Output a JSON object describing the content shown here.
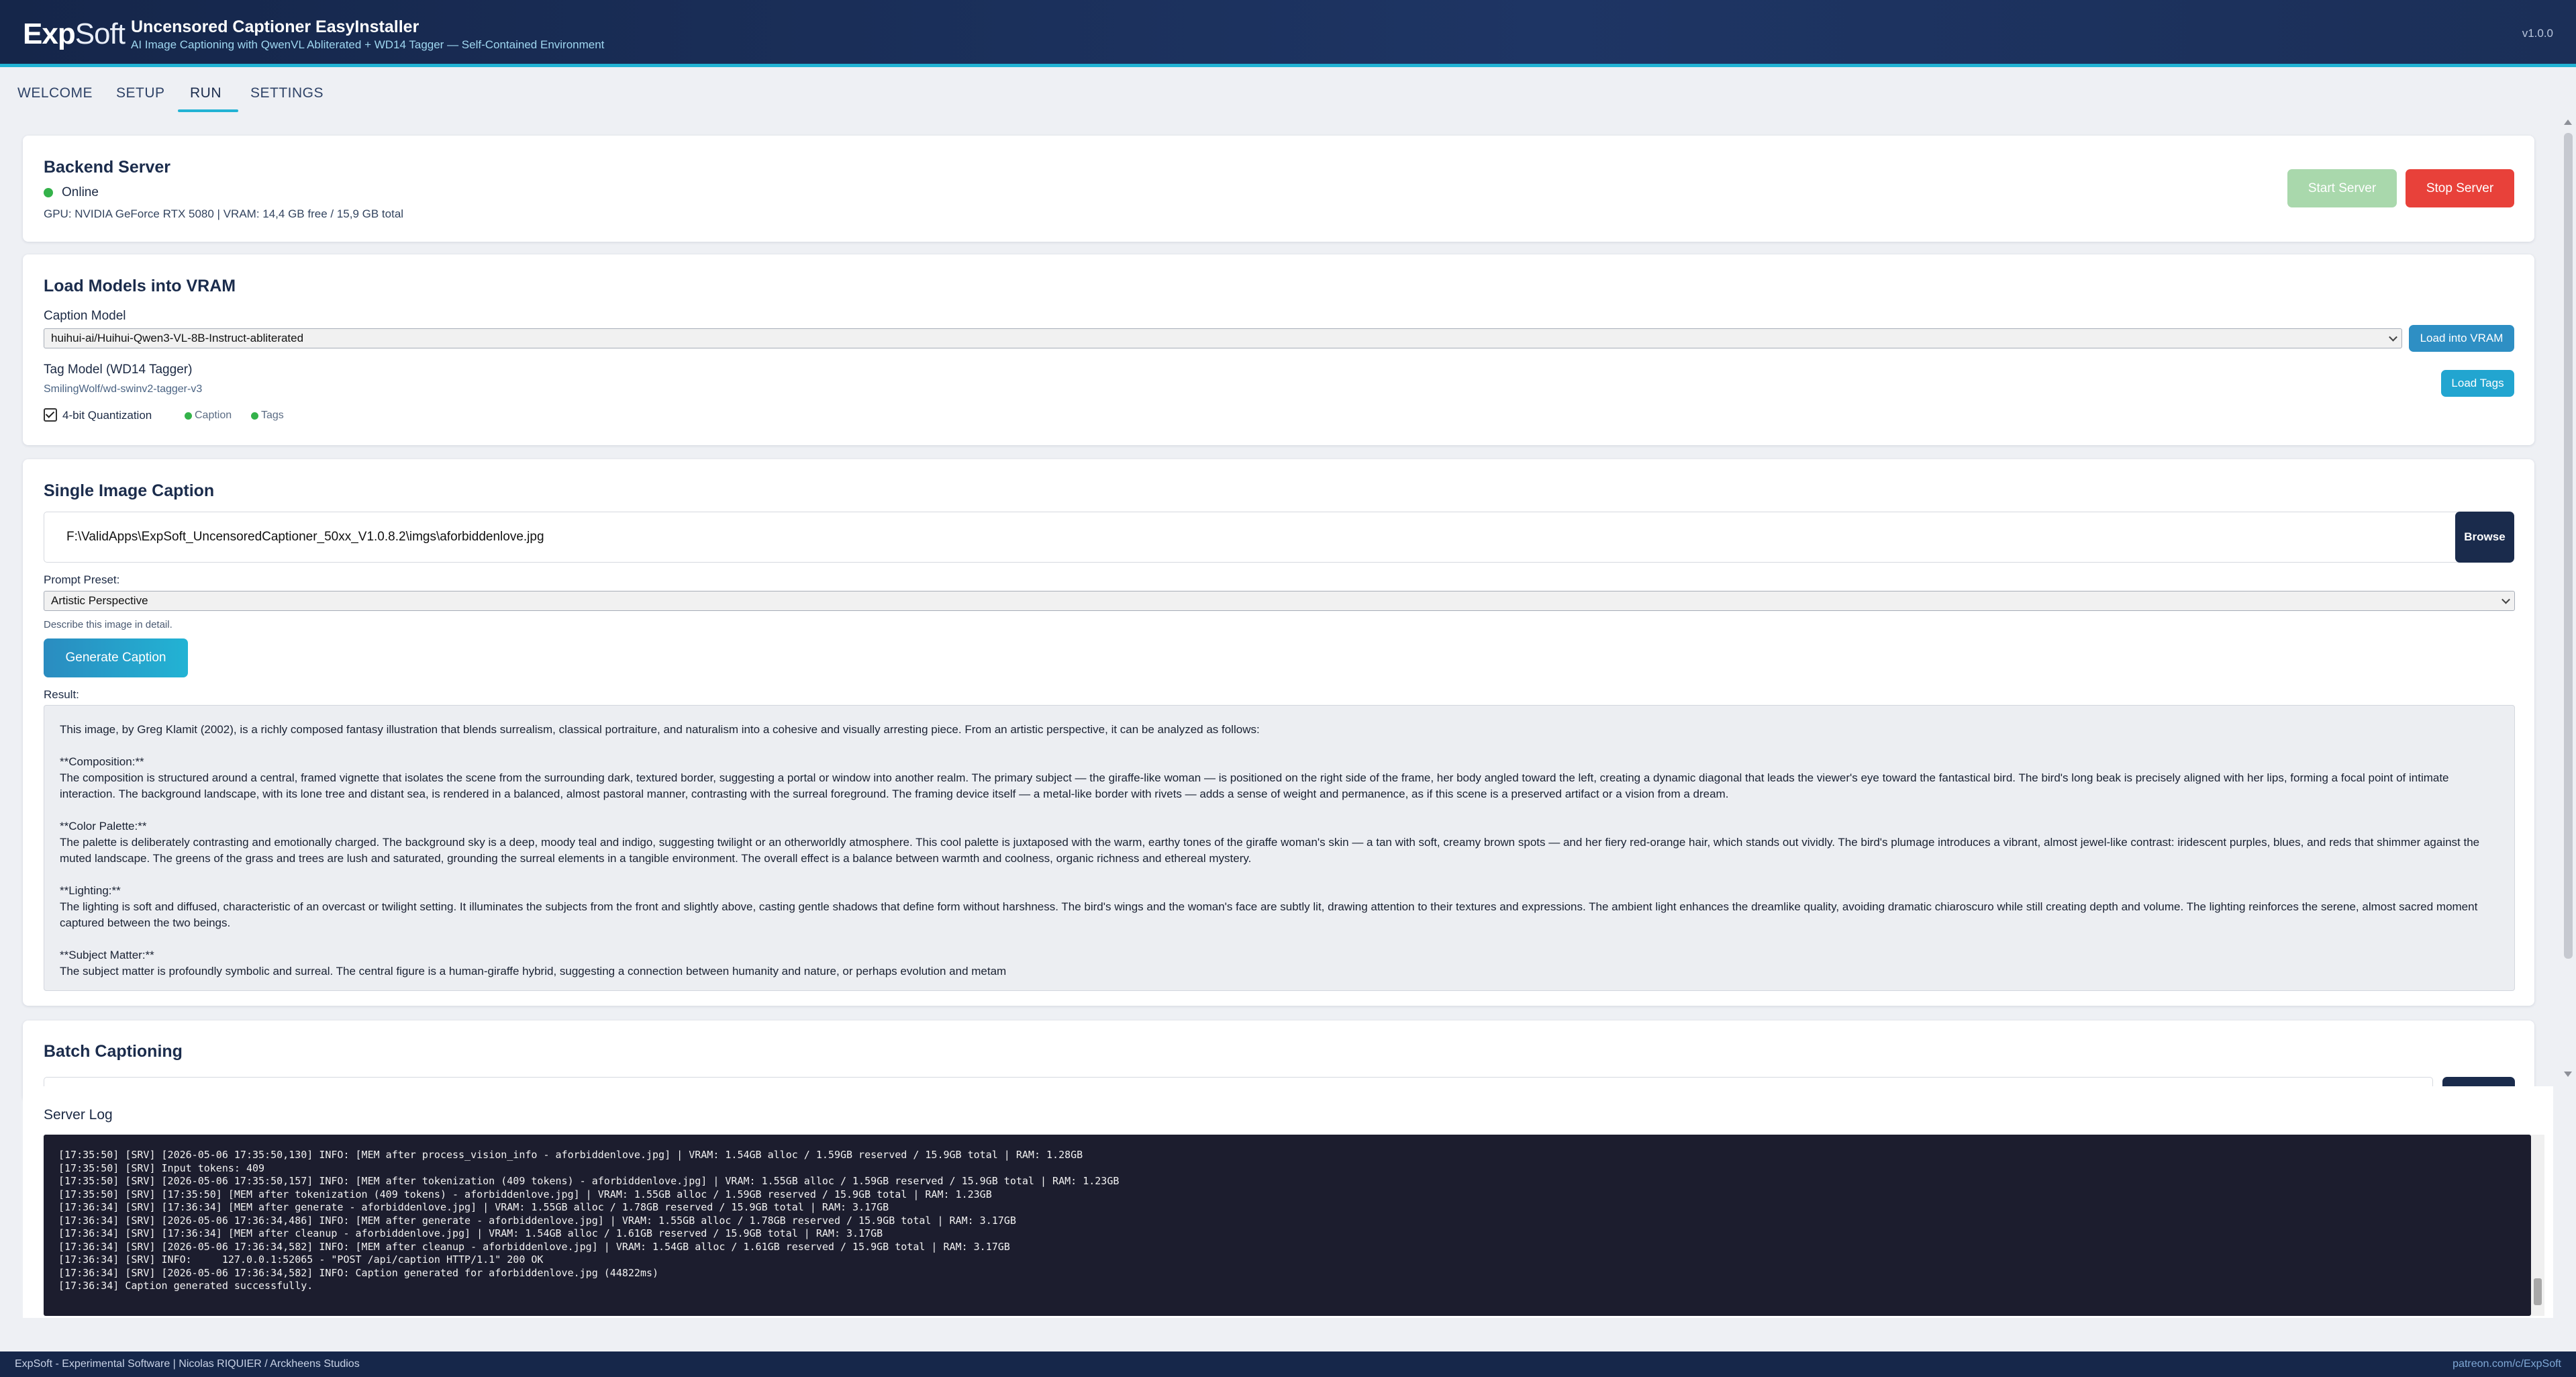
{
  "header": {
    "logo_bold": "Exp",
    "logo_light": "Soft",
    "title": "Uncensored Captioner EasyInstaller",
    "subtitle": "AI Image Captioning with QwenVL Abliterated + WD14 Tagger — Self-Contained Environment",
    "version": "v1.0.0"
  },
  "tabs": [
    {
      "label": "WELCOME"
    },
    {
      "label": "SETUP"
    },
    {
      "label": "RUN",
      "active": true
    },
    {
      "label": "SETTINGS"
    }
  ],
  "backend": {
    "title": "Backend Server",
    "status": "Online",
    "gpu_info": "GPU: NVIDIA GeForce RTX 5080  | VRAM: 14,4 GB free / 15,9 GB total",
    "start_label": "Start Server",
    "stop_label": "Stop Server"
  },
  "models": {
    "title": "Load Models into VRAM",
    "caption_label": "Caption Model",
    "caption_value": "huihui-ai/Huihui-Qwen3-VL-8B-Instruct-abliterated",
    "load_vram_label": "Load into VRAM",
    "tag_label": "Tag Model (WD14 Tagger)",
    "tag_value": "SmilingWolf/wd-swinv2-tagger-v3",
    "load_tags_label": "Load Tags",
    "quant_label": "4-bit Quantization",
    "caption_status": "Caption",
    "tags_status": "Tags"
  },
  "single": {
    "title": "Single Image Caption",
    "path_value": "F:\\ValidApps\\ExpSoft_UncensoredCaptioner_50xx_V1.0.8.2\\imgs\\aforbiddenlove.jpg",
    "browse_label": "Browse",
    "preset_label": "Prompt Preset:",
    "preset_value": "Artistic Perspective",
    "preset_hint": "Describe this image in detail.",
    "generate_label": "Generate Caption",
    "result_label": "Result:",
    "result_paragraphs": [
      "This image, by Greg Klamit (2002), is a richly composed fantasy illustration that blends surrealism, classical portraiture, and naturalism into a cohesive and visually arresting piece. From an artistic perspective, it can be analyzed as follows:",
      "**Composition:**\nThe composition is structured around a central, framed vignette that isolates the scene from the surrounding dark, textured border, suggesting a portal or window into another realm. The primary subject — the giraffe-like woman — is positioned on the right side of the frame, her body angled toward the left, creating a dynamic diagonal that leads the viewer's eye toward the fantastical bird. The bird's long beak is precisely aligned with her lips, forming a focal point of intimate interaction. The background landscape, with its lone tree and distant sea, is rendered in a balanced, almost pastoral manner, contrasting with the surreal foreground. The framing device itself — a metal-like border with rivets — adds a sense of weight and permanence, as if this scene is a preserved artifact or a vision from a dream.",
      "**Color Palette:**\nThe palette is deliberately contrasting and emotionally charged. The background sky is a deep, moody teal and indigo, suggesting twilight or an otherworldly atmosphere. This cool palette is juxtaposed with the warm, earthy tones of the giraffe woman's skin — a tan with soft, creamy brown spots — and her fiery red-orange hair, which stands out vividly. The bird's plumage introduces a vibrant, almost jewel-like contrast: iridescent purples, blues, and reds that shimmer against the muted landscape. The greens of the grass and trees are lush and saturated, grounding the surreal elements in a tangible environment. The overall effect is a balance between warmth and coolness, organic richness and ethereal mystery.",
      "**Lighting:**\nThe lighting is soft and diffused, characteristic of an overcast or twilight setting. It illuminates the subjects from the front and slightly above, casting gentle shadows that define form without harshness. The bird's wings and the woman's face are subtly lit, drawing attention to their textures and expressions. The ambient light enhances the dreamlike quality, avoiding dramatic chiaroscuro while still creating depth and volume. The lighting reinforces the serene, almost sacred moment captured between the two beings.",
      "**Subject Matter:**\nThe subject matter is profoundly symbolic and surreal. The central figure is a human-giraffe hybrid, suggesting a connection between humanity and nature, or perhaps evolution and metam"
    ]
  },
  "batch": {
    "title": "Batch Captioning"
  },
  "log": {
    "title": "Server Log",
    "lines": [
      "[17:35:50] [SRV] [2026-05-06 17:35:50,130] INFO: [MEM after process_vision_info - aforbiddenlove.jpg] | VRAM: 1.54GB alloc / 1.59GB reserved / 15.9GB total | RAM: 1.28GB",
      "[17:35:50] [SRV] Input tokens: 409",
      "[17:35:50] [SRV] [2026-05-06 17:35:50,157] INFO: [MEM after tokenization (409 tokens) - aforbiddenlove.jpg] | VRAM: 1.55GB alloc / 1.59GB reserved / 15.9GB total | RAM: 1.23GB",
      "[17:35:50] [SRV] [17:35:50] [MEM after tokenization (409 tokens) - aforbiddenlove.jpg] | VRAM: 1.55GB alloc / 1.59GB reserved / 15.9GB total | RAM: 1.23GB",
      "[17:36:34] [SRV] [17:36:34] [MEM after generate - aforbiddenlove.jpg] | VRAM: 1.55GB alloc / 1.78GB reserved / 15.9GB total | RAM: 3.17GB",
      "[17:36:34] [SRV] [2026-05-06 17:36:34,486] INFO: [MEM after generate - aforbiddenlove.jpg] | VRAM: 1.55GB alloc / 1.78GB reserved / 15.9GB total | RAM: 3.17GB",
      "[17:36:34] [SRV] [17:36:34] [MEM after cleanup - aforbiddenlove.jpg] | VRAM: 1.54GB alloc / 1.61GB reserved / 15.9GB total | RAM: 3.17GB",
      "[17:36:34] [SRV] [2026-05-06 17:36:34,582] INFO: [MEM after cleanup - aforbiddenlove.jpg] | VRAM: 1.54GB alloc / 1.61GB reserved / 15.9GB total | RAM: 3.17GB",
      "[17:36:34] [SRV] INFO:     127.0.0.1:52065 - \"POST /api/caption HTTP/1.1\" 200 OK",
      "[17:36:34] [SRV] [2026-05-06 17:36:34,582] INFO: Caption generated for aforbiddenlove.jpg (44822ms)",
      "[17:36:34] Caption generated successfully."
    ]
  },
  "footer": {
    "left": "ExpSoft - Experimental Software |  Nicolas RIQUIER / Arckheens Studios",
    "right": "patreon.com/c/ExpSoft"
  },
  "colors": {
    "accent": "#22b3d4",
    "stop": "#e8413a",
    "start_disabled": "#a9d8ac",
    "browse": "#1a2b4c",
    "online": "#34b24a"
  }
}
